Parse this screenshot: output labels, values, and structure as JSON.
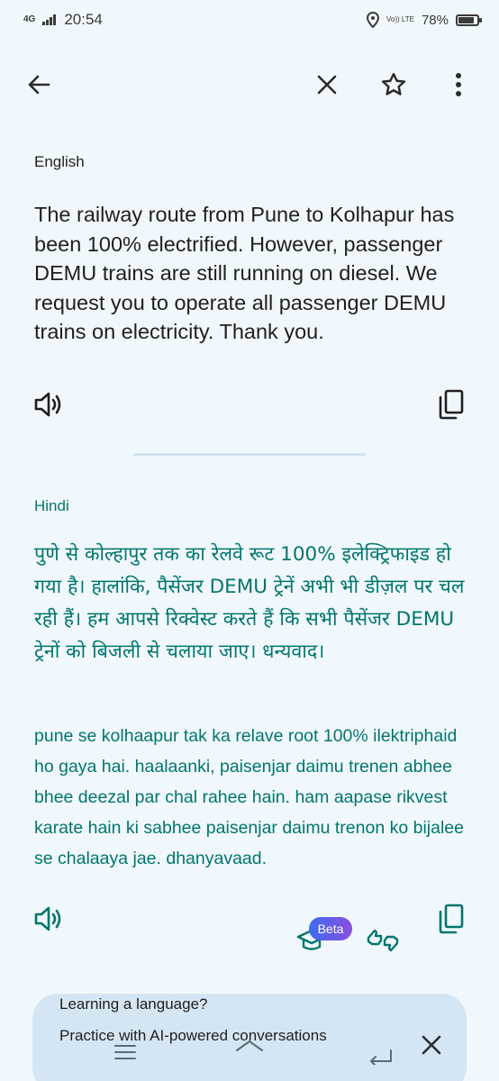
{
  "status_bar": {
    "network": "4G",
    "time": "20:54",
    "volte": "Vo)) LTE",
    "battery": "78%",
    "battery_level": 0.78
  },
  "toolbar": {
    "back_icon": "arrow-left-icon",
    "close_icon": "close-icon",
    "star_icon": "star-outline-icon",
    "more_icon": "more-vert-icon"
  },
  "source": {
    "language": "English",
    "text": "The railway route from Pune to Kolhapur has been 100% electrified. However, passenger DEMU trains are still running on diesel. We request you to operate all passenger DEMU trains on electricity. Thank you."
  },
  "target": {
    "language": "Hindi",
    "text": "पुणे से कोल्हापुर तक का रेलवे रूट 100% इलेक्ट्रिफाइड हो गया है। हालांकि, पैसेंजर DEMU ट्रेनें अभी भी डीज़ल पर चल रही हैं। हम आपसे रिक्वेस्ट करते हैं कि सभी पैसेंजर DEMU ट्रेनों को बिजली से चलाया जाए। धन्यवाद।",
    "transliteration": "pune se kolhaapur tak ka relave root 100% ilektriphaid ho gaya hai. haalaanki, paisenjar daimu trenen abhee bhee deezal par chal rahee hain. ham aapase rikvest karate hain ki sabhee paisenjar daimu trenon ko bijalee se chalaaya jae. dhanyavaad.",
    "beta_badge": "Beta"
  },
  "promo": {
    "title": "Learning a language?",
    "subtitle": "Practice with AI-powered conversations"
  },
  "colors": {
    "background": "#f1f8fd",
    "accent": "#00766d",
    "card": "#d4e6f3"
  }
}
